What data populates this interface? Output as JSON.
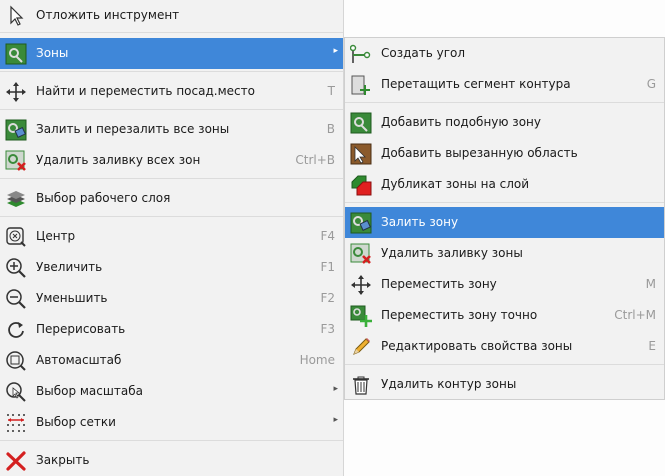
{
  "main_menu": {
    "items": [
      {
        "label": "Отложить инструмент",
        "shortcut": "",
        "icon": "cursor-arrow-icon"
      },
      {
        "label": "Зоны",
        "shortcut": "",
        "icon": "zone-icon",
        "submenu": true
      },
      {
        "label": "Найти и переместить посад.место",
        "shortcut": "T",
        "icon": "move-arrows-icon"
      },
      {
        "label": "Залить и перезалить все зоны",
        "shortcut": "B",
        "icon": "fill-zones-icon"
      },
      {
        "label": "Удалить заливку всех зон",
        "shortcut": "Ctrl+B",
        "icon": "unfill-zones-icon"
      },
      {
        "label": "Выбор рабочего слоя",
        "shortcut": "",
        "icon": "layers-icon"
      },
      {
        "label": "Центр",
        "shortcut": "F4",
        "icon": "zoom-center-icon"
      },
      {
        "label": "Увеличить",
        "shortcut": "F1",
        "icon": "zoom-in-icon"
      },
      {
        "label": "Уменьшить",
        "shortcut": "F2",
        "icon": "zoom-out-icon"
      },
      {
        "label": "Перерисовать",
        "shortcut": "F3",
        "icon": "redraw-icon"
      },
      {
        "label": "Автомасштаб",
        "shortcut": "Home",
        "icon": "zoom-fit-icon"
      },
      {
        "label": "Выбор масштаба",
        "shortcut": "",
        "icon": "zoom-select-icon",
        "submenu": true
      },
      {
        "label": "Выбор сетки",
        "shortcut": "",
        "icon": "grid-icon",
        "submenu": true
      },
      {
        "label": "Закрыть",
        "shortcut": "",
        "icon": "close-icon"
      }
    ]
  },
  "zones_submenu": {
    "items": [
      {
        "label": "Создать угол",
        "shortcut": "",
        "icon": "create-corner-icon"
      },
      {
        "label": "Перетащить сегмент контура",
        "shortcut": "G",
        "icon": "drag-segment-icon"
      },
      {
        "label": "Добавить подобную зону",
        "shortcut": "",
        "icon": "add-similar-zone-icon"
      },
      {
        "label": "Добавить вырезанную область",
        "shortcut": "",
        "icon": "add-cutout-icon"
      },
      {
        "label": "Дубликат зоны на слой",
        "shortcut": "",
        "icon": "duplicate-zone-icon"
      },
      {
        "label": "Залить зону",
        "shortcut": "",
        "icon": "fill-zone-icon"
      },
      {
        "label": "Удалить заливку зоны",
        "shortcut": "",
        "icon": "unfill-zone-icon"
      },
      {
        "label": "Переместить зону",
        "shortcut": "M",
        "icon": "move-zone-icon"
      },
      {
        "label": "Переместить зону точно",
        "shortcut": "Ctrl+M",
        "icon": "move-zone-exact-icon"
      },
      {
        "label": "Редактировать свойства зоны",
        "shortcut": "E",
        "icon": "edit-pencil-icon"
      },
      {
        "label": "Удалить контур зоны",
        "shortcut": "",
        "icon": "trash-icon"
      }
    ]
  },
  "colors": {
    "highlight": "#3f87d9",
    "zone_green": "#3a8a3a",
    "delete_red": "#d42020"
  }
}
